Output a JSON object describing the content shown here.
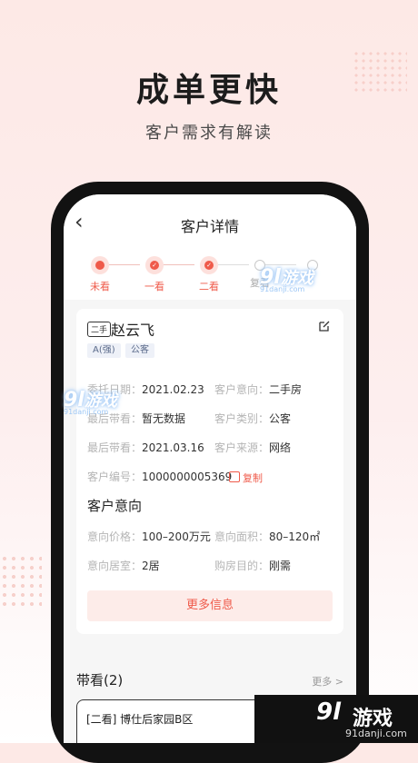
{
  "hero": {
    "title": "成单更快",
    "subtitle": "客户需求有解读"
  },
  "nav": {
    "title": "客户详情"
  },
  "steps": [
    {
      "label": "未看",
      "state": "current"
    },
    {
      "label": "一看",
      "state": "done"
    },
    {
      "label": "二看",
      "state": "done"
    },
    {
      "label": "复看",
      "state": "pending"
    },
    {
      "label": "",
      "state": "pending"
    }
  ],
  "customer": {
    "type_tag": "二手",
    "name": "赵云飞",
    "badges": [
      "A(强)",
      "公客"
    ],
    "fields": [
      {
        "label": "委托日期：",
        "value": "2021.02.23",
        "label2": "客户意向：",
        "value2": "二手房"
      },
      {
        "label": "最后带看：",
        "value": "暂无数据",
        "label2": "客户类别：",
        "value2": "公客"
      },
      {
        "label": "最后带看：",
        "value": "2021.03.16",
        "label2": "客户来源：",
        "value2": "网络"
      }
    ],
    "number_label": "客户编号：",
    "number_value": "1000000005369",
    "copy_label": "复制"
  },
  "intent": {
    "title": "客户意向",
    "fields": [
      {
        "label": "意向价格：",
        "value": "100–200万元",
        "label2": "意向面积：",
        "value2": "80–120㎡"
      },
      {
        "label": "意向居室：",
        "value": "2居",
        "label2": "购房目的：",
        "value2": "刚需"
      }
    ],
    "more_button": "更多信息"
  },
  "visits": {
    "title": "带看(2)",
    "more": "更多 >",
    "first_item": "[二看] 博仕后家园B区"
  },
  "watermark": {
    "logo_num": "9l",
    "logo_text": "游戏",
    "url": "91danji.com"
  },
  "colors": {
    "accent": "#ef5a4a",
    "badge_bg": "#eef1f8",
    "phone_frame": "#121212"
  }
}
